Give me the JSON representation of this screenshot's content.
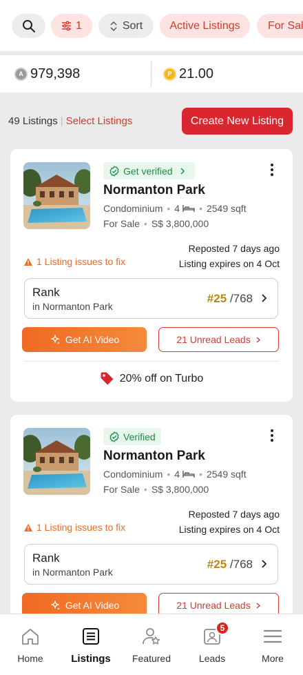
{
  "filters": {
    "filter_count": "1",
    "sort_label": "Sort",
    "active_listings_label": "Active Listings",
    "for_sale_label": "For Sale"
  },
  "balances": {
    "credits": "979,398",
    "credits_icon": "credit-coin-icon",
    "points": "21.00",
    "points_icon": "gold-coin-icon"
  },
  "listings_header": {
    "count": "49 Listings",
    "select_label": "Select Listings",
    "create_label": "Create New Listing"
  },
  "listings": [
    {
      "badge": "Get verified",
      "title": "Normanton Park",
      "property_type": "Condominium",
      "beds": "4",
      "area": "2549 sqft",
      "listing_type": "For Sale",
      "price": "S$ 3,800,000",
      "issues": "1 Listing issues to fix",
      "reposted": "Reposted 7 days ago",
      "expires": "Listing expires on 4 Oct",
      "rank_label": "Rank",
      "rank_scope": "in Normanton Park",
      "rank_position": "#25",
      "rank_total": "/768",
      "ai_video_label": "Get AI Video",
      "leads_label": "21 Unread Leads",
      "promo": "20% off on Turbo"
    },
    {
      "badge": "Verified",
      "title": "Normanton Park",
      "property_type": "Condominium",
      "beds": "4",
      "area": "2549 sqft",
      "listing_type": "For Sale",
      "price": "S$ 3,800,000",
      "issues": "1 Listing issues to fix",
      "reposted": "Reposted 7 days ago",
      "expires": "Listing expires on 4 Oct",
      "rank_label": "Rank",
      "rank_scope": "in Normanton Park",
      "rank_position": "#25",
      "rank_total": "/768",
      "ai_video_label": "Get AI Video",
      "leads_label": "21 Unread Leads"
    }
  ],
  "nav": {
    "home": "Home",
    "listings": "Listings",
    "featured": "Featured",
    "leads": "Leads",
    "leads_badge": "5",
    "more": "More"
  },
  "colors": {
    "brand_red": "#d9262f",
    "ai_orange": "#f06a23",
    "verified_green": "#1c8f43",
    "rank_gold": "#b8890f"
  }
}
